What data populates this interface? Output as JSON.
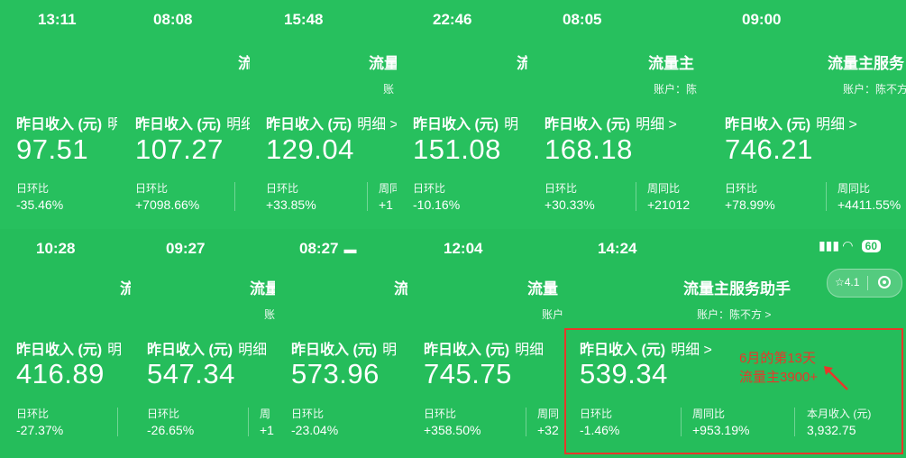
{
  "row1": [
    {
      "time": "13:11",
      "title": "",
      "account": "",
      "label": "昨日收入 (元)",
      "detail": "明",
      "amount": "97.51",
      "s1_label": "日环比",
      "s1_value": "-35.46%",
      "s2_label": "",
      "s2_value": ""
    },
    {
      "time": "08:08",
      "title": "流",
      "account": "",
      "label": "昨日收入 (元)",
      "detail": "明细",
      "amount": "107.27",
      "s1_label": "日环比",
      "s1_value": "+7098.66%",
      "s2_label": "",
      "s2_value": ""
    },
    {
      "time": "15:48",
      "title": "流量",
      "account": "账",
      "label": "昨日收入 (元)",
      "detail": "明细 >",
      "amount": "129.04",
      "s1_label": "日环比",
      "s1_value": "+33.85%",
      "s2_label": "周同",
      "s2_value": "+1"
    },
    {
      "time": "22:46",
      "title": "流",
      "account": "",
      "label": "昨日收入 (元)",
      "detail": "明",
      "amount": "151.08",
      "s1_label": "日环比",
      "s1_value": "-10.16%",
      "s2_label": "",
      "s2_value": ""
    },
    {
      "time": "08:05",
      "title": "流量主",
      "account": "账户：陈",
      "label": "昨日收入 (元)",
      "detail": "明细 >",
      "amount": "168.18",
      "s1_label": "日环比",
      "s1_value": "+30.33%",
      "s2_label": "周同比",
      "s2_value": "+21012"
    },
    {
      "time": "09:00",
      "title": "流量主服务",
      "account": "账户：陈不方",
      "label": "昨日收入 (元)",
      "detail": "明细 >",
      "amount": "746.21",
      "s1_label": "日环比",
      "s1_value": "+78.99%",
      "s2_label": "周同比",
      "s2_value": "+4411.55%"
    }
  ],
  "row2": [
    {
      "time": "10:28",
      "title": "流",
      "account": "",
      "label": "昨日收入 (元)",
      "detail": "明",
      "amount": "416.89",
      "s1_label": "日环比",
      "s1_value": "-27.37%",
      "s2_label": "",
      "s2_value": ""
    },
    {
      "time": "09:27",
      "title": "流量",
      "account": "账",
      "label": "昨日收入 (元)",
      "detail": "明细",
      "amount": "547.34",
      "s1_label": "日环比",
      "s1_value": "-26.65%",
      "s2_label": "周",
      "s2_value": "+1"
    },
    {
      "time": "08:27",
      "title": "流",
      "account": "",
      "label": "昨日收入 (元)",
      "detail": "明",
      "amount": "573.96",
      "s1_label": "日环比",
      "s1_value": "-23.04%",
      "s2_label": "",
      "s2_value": ""
    },
    {
      "time": "12:04",
      "title": "流量",
      "account": "账户",
      "label": "昨日收入 (元)",
      "detail": "明细",
      "amount": "745.75",
      "s1_label": "日环比",
      "s1_value": "+358.50%",
      "s2_label": "周同",
      "s2_value": "+32"
    },
    {
      "time": "14:24",
      "title": "流量主服务助手",
      "account": "账户：陈不方 >",
      "label": "昨日收入 (元)",
      "detail": "明细 >",
      "amount": "539.34",
      "s1_label": "日环比",
      "s1_value": "-1.46%",
      "s2_label": "周同比",
      "s2_value": "+953.19%",
      "s3_label": "本月收入 (元)",
      "s3_value": "3,932.75"
    }
  ],
  "status": {
    "battery": "60"
  },
  "capsule": {
    "rating": "☆4.1"
  },
  "annotation": {
    "line1": "6月的第13天",
    "line2": "流量主3900+"
  },
  "colors": {
    "background": "#26be5c",
    "highlight": "#e8372a"
  }
}
